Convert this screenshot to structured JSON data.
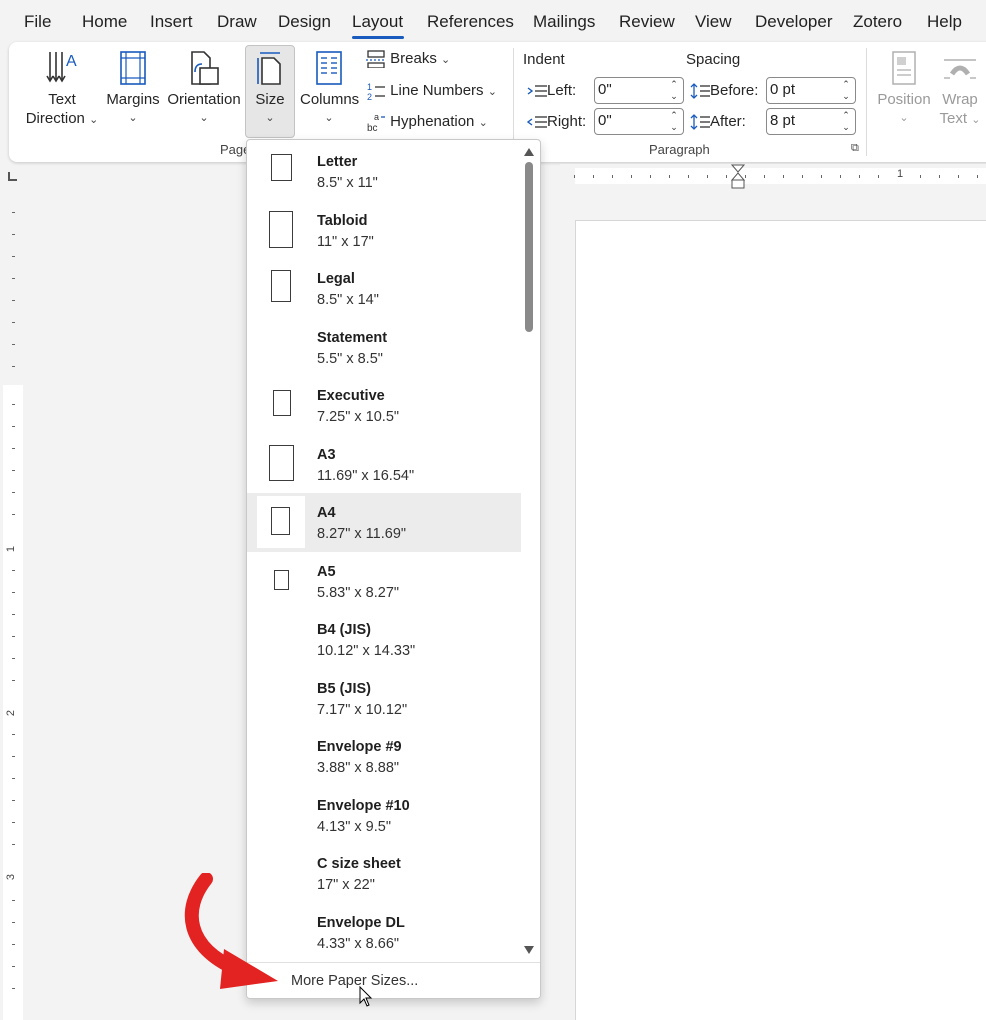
{
  "menu": {
    "tabs": [
      "File",
      "Home",
      "Insert",
      "Draw",
      "Design",
      "Layout",
      "References",
      "Mailings",
      "Review",
      "View",
      "Developer",
      "Zotero",
      "Help"
    ],
    "active_tab": "Layout",
    "accent_color": "#185abd"
  },
  "ribbon": {
    "text_direction": {
      "line1": "Text",
      "line2": "Direction"
    },
    "margins": "Margins",
    "orientation": "Orientation",
    "size": "Size",
    "columns": "Columns",
    "breaks": "Breaks",
    "line_numbers": "Line Numbers",
    "hyphenation": "Hyphenation",
    "page_setup_group_partial": "Page",
    "indent": {
      "heading": "Indent",
      "left_label": "Left:",
      "left_value": "0\"",
      "right_label": "Right:",
      "right_value": "0\""
    },
    "spacing": {
      "heading": "Spacing",
      "before_label": "Before:",
      "before_value": "0 pt",
      "after_label": "After:",
      "after_value": "8 pt"
    },
    "paragraph_group": "Paragraph",
    "position": "Position",
    "wrap_text": {
      "line1": "Wrap",
      "line2": "Text"
    }
  },
  "ruler": {
    "mark": "1",
    "v_marks": [
      "1",
      "2",
      "3"
    ]
  },
  "size_dropdown": {
    "items": [
      {
        "name": "Letter",
        "dims": "8.5\" x 11\"",
        "icon": "letter-page-icon"
      },
      {
        "name": "Tabloid",
        "dims": "11\" x 17\"",
        "icon": "tabloid-page-icon"
      },
      {
        "name": "Legal",
        "dims": "8.5\" x 14\"",
        "icon": "legal-page-icon"
      },
      {
        "name": "Statement",
        "dims": "5.5\" x 8.5\"",
        "icon": ""
      },
      {
        "name": "Executive",
        "dims": "7.25\" x 10.5\"",
        "icon": "executive-page-icon"
      },
      {
        "name": "A3",
        "dims": "11.69\" x 16.54\"",
        "icon": "a3-page-icon"
      },
      {
        "name": "A4",
        "dims": "8.27\" x 11.69\"",
        "icon": "a4-page-icon"
      },
      {
        "name": "A5",
        "dims": "5.83\" x 8.27\"",
        "icon": "a5-page-icon"
      },
      {
        "name": "B4 (JIS)",
        "dims": "10.12\" x 14.33\"",
        "icon": ""
      },
      {
        "name": "B5 (JIS)",
        "dims": "7.17\" x 10.12\"",
        "icon": ""
      },
      {
        "name": "Envelope #9",
        "dims": "3.88\" x 8.88\"",
        "icon": ""
      },
      {
        "name": "Envelope #10",
        "dims": "4.13\" x 9.5\"",
        "icon": ""
      },
      {
        "name": "C size sheet",
        "dims": "17\" x 22\"",
        "icon": ""
      },
      {
        "name": "Envelope DL",
        "dims": "4.33\" x 8.66\"",
        "icon": ""
      }
    ],
    "selected": "A4",
    "footer": "More Paper Sizes...",
    "annotation_arrow_color": "#e32222"
  }
}
